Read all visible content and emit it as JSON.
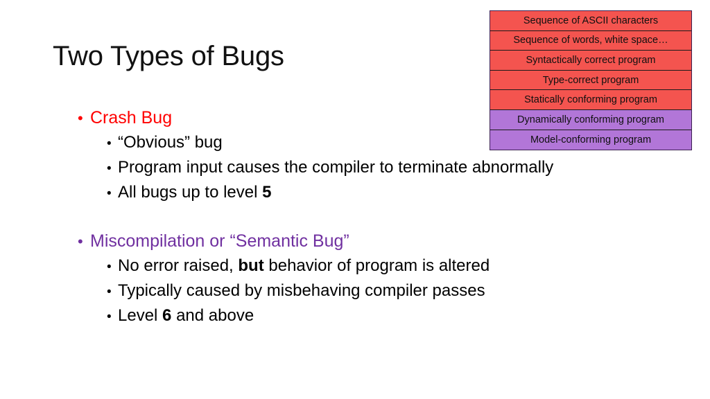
{
  "slide": {
    "title": "Two Types of Bugs",
    "background_color": "#ffffff"
  },
  "colors": {
    "crash_bug_text": "#ff0000",
    "semantic_bug_text": "#7030a0",
    "table_red": "#f4544f",
    "table_purple": "#b276d8",
    "table_border": "#1a1a1a"
  },
  "bullets": {
    "crash": {
      "bullet_glyph": "•",
      "label": "Crash Bug",
      "sub": [
        {
          "glyph": "•",
          "pre": "“Obvious” bug",
          "bold": "",
          "post": ""
        },
        {
          "glyph": "•",
          "pre": "Program input causes the compiler to terminate abnormally",
          "bold": "",
          "post": ""
        },
        {
          "glyph": "•",
          "pre": "All bugs up to level ",
          "bold": "5",
          "post": ""
        }
      ]
    },
    "semantic": {
      "bullet_glyph": "•",
      "label": "Miscompilation or “Semantic Bug”",
      "sub": [
        {
          "glyph": "•",
          "pre": "No error raised, ",
          "bold": "but",
          "post": " behavior of program is altered"
        },
        {
          "glyph": "•",
          "pre": "Typically caused by misbehaving compiler passes",
          "bold": "",
          "post": ""
        },
        {
          "glyph": "•",
          "pre": "Level ",
          "bold": "6",
          "post": " and above"
        }
      ]
    }
  },
  "stack_table": {
    "rows": [
      {
        "label": "Sequence of ASCII characters",
        "color": "red"
      },
      {
        "label": "Sequence of words, white space…",
        "color": "red"
      },
      {
        "label": "Syntactically correct program",
        "color": "red"
      },
      {
        "label": "Type-correct program",
        "color": "red"
      },
      {
        "label": "Statically conforming program",
        "color": "red"
      },
      {
        "label": "Dynamically conforming program",
        "color": "purple"
      },
      {
        "label": "Model-conforming program",
        "color": "purple"
      }
    ]
  }
}
